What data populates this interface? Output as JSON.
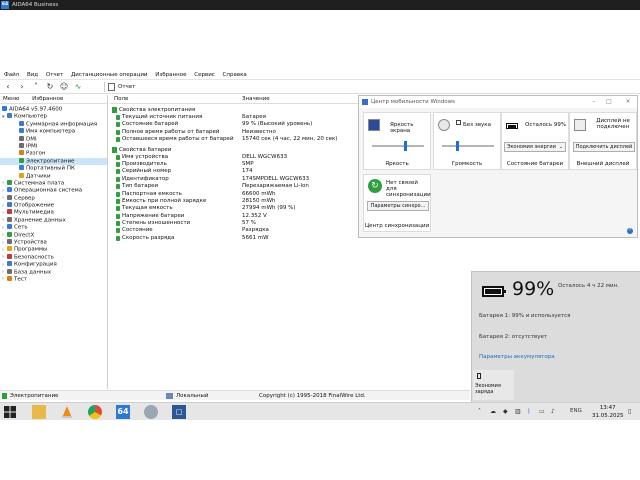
{
  "window": {
    "title": "AIDA64 Business",
    "menu": [
      "Файл",
      "Вид",
      "Отчет",
      "Дистанционные операции",
      "Избранное",
      "Сервис",
      "Справка"
    ],
    "report_button": "Отчет",
    "tabs": [
      "Меню",
      "Избранное"
    ]
  },
  "tree": {
    "root": "AIDA64 v5.97.4600",
    "items": [
      {
        "label": "Компьютер",
        "level": 1,
        "color": "#3a7bd5",
        "arrow": "▾"
      },
      {
        "label": "Суммарная информация",
        "level": 2,
        "color": "#3a7bd5"
      },
      {
        "label": "Имя компьютера",
        "level": 2,
        "color": "#3a7bd5"
      },
      {
        "label": "DMI",
        "level": 2,
        "color": "#6d6d6d"
      },
      {
        "label": "IPMI",
        "level": 2,
        "color": "#6d6d6d"
      },
      {
        "label": "Разгон",
        "level": 2,
        "color": "#e07b1a"
      },
      {
        "label": "Электропитание",
        "level": 2,
        "color": "#2e9e3f",
        "selected": true
      },
      {
        "label": "Портативный ПК",
        "level": 2,
        "color": "#3a7bd5"
      },
      {
        "label": "Датчики",
        "level": 2,
        "color": "#e0a21a"
      },
      {
        "label": "Системная плата",
        "level": 1,
        "color": "#2e9e3f",
        "arrow": "›"
      },
      {
        "label": "Операционная система",
        "level": 1,
        "color": "#3a7bd5",
        "arrow": "›"
      },
      {
        "label": "Сервер",
        "level": 1,
        "color": "#6d6d6d",
        "arrow": "›"
      },
      {
        "label": "Отображение",
        "level": 1,
        "color": "#3a7bd5",
        "arrow": "›"
      },
      {
        "label": "Мультимедиа",
        "level": 1,
        "color": "#c23b3b",
        "arrow": "›"
      },
      {
        "label": "Хранение данных",
        "level": 1,
        "color": "#6d6d6d",
        "arrow": "›"
      },
      {
        "label": "Сеть",
        "level": 1,
        "color": "#3a7bd5",
        "arrow": "›"
      },
      {
        "label": "DirectX",
        "level": 1,
        "color": "#2e9e3f",
        "arrow": "›"
      },
      {
        "label": "Устройства",
        "level": 1,
        "color": "#6d6d6d",
        "arrow": "›"
      },
      {
        "label": "Программы",
        "level": 1,
        "color": "#e0a21a",
        "arrow": "›"
      },
      {
        "label": "Безопасность",
        "level": 1,
        "color": "#c23b3b",
        "arrow": "›"
      },
      {
        "label": "Конфигурация",
        "level": 1,
        "color": "#3a7bd5",
        "arrow": "›"
      },
      {
        "label": "База данных",
        "level": 1,
        "color": "#6d6d6d",
        "arrow": "›"
      },
      {
        "label": "Тест",
        "level": 1,
        "color": "#e07b1a",
        "arrow": "›"
      }
    ]
  },
  "report": {
    "col_field": "Поле",
    "col_value": "Значение",
    "sections": [
      {
        "title": "Свойства электропитания",
        "rows": [
          {
            "f": "Текущий источник питания",
            "v": "Батарея"
          },
          {
            "f": "Состояние батарей",
            "v": "99 % (Высокий уровень)"
          },
          {
            "f": "Полное время работы от батарей",
            "v": "Неизвестно"
          },
          {
            "f": "Оставшееся время работы от батарей",
            "v": "15740 сек (4 час, 22 мин, 20 сек)"
          }
        ]
      },
      {
        "title": "Свойства батареи",
        "rows": [
          {
            "f": "Имя устройства",
            "v": "DELL WGCW633"
          },
          {
            "f": "Производитель",
            "v": "SMP"
          },
          {
            "f": "Серийный номер",
            "v": "174"
          },
          {
            "f": "Идентификатор",
            "v": "174SMPDELL WGCW633"
          },
          {
            "f": "Тип батареи",
            "v": "Перезаряжаемая Li-Ion"
          },
          {
            "f": "Паспортная емкость",
            "v": "66600 mWh"
          },
          {
            "f": "Емкость при полной зарядке",
            "v": "28150 mWh"
          },
          {
            "f": "Текущая емкость",
            "v": "27994 mWh  (99 %)"
          },
          {
            "f": "Напряжение батареи",
            "v": "12.352 V"
          },
          {
            "f": "Степень изношенности",
            "v": "57 %"
          },
          {
            "f": "Состояние",
            "v": "Разрядка"
          },
          {
            "f": "Скорость разряда",
            "v": "5661 mW"
          }
        ]
      }
    ]
  },
  "statusbar": {
    "left": "Электропитание",
    "mid": "Локальный",
    "copyright": "Copyright (c) 1995-2018 FinalWire Ltd."
  },
  "mobility": {
    "title": "Центр мобильности Windows",
    "brightness_label": "Яркость экрана",
    "brightness_caption": "Яркость",
    "mute_label": "Без звука",
    "volume_caption": "Громкость",
    "battery_label": "Осталось 99%",
    "battery_select": "Экономия энергии",
    "battery_caption": "Состояние батареи",
    "display_label": "Дисплей не подключен",
    "display_button": "Подключить дисплей",
    "display_caption": "Внешний дисплей",
    "sync_label": "Нет связей для синхронизации",
    "sync_button": "Параметры синхро...",
    "sync_caption": "Центр синхронизации"
  },
  "flyout": {
    "percent": "99%",
    "remaining": "Осталось 4 ч 22 мин.",
    "battery_level": 0.99,
    "battery1": "Батарея 1: 99% и используется",
    "battery2": "Батарея 2: отсутствует",
    "settings_link": "Параметры аккумулятора",
    "saver_label": "Экономия заряда"
  },
  "taskbar": {
    "lang": "ENG",
    "time": "13:47",
    "date": "31.05.2025",
    "aida_label": "64"
  }
}
